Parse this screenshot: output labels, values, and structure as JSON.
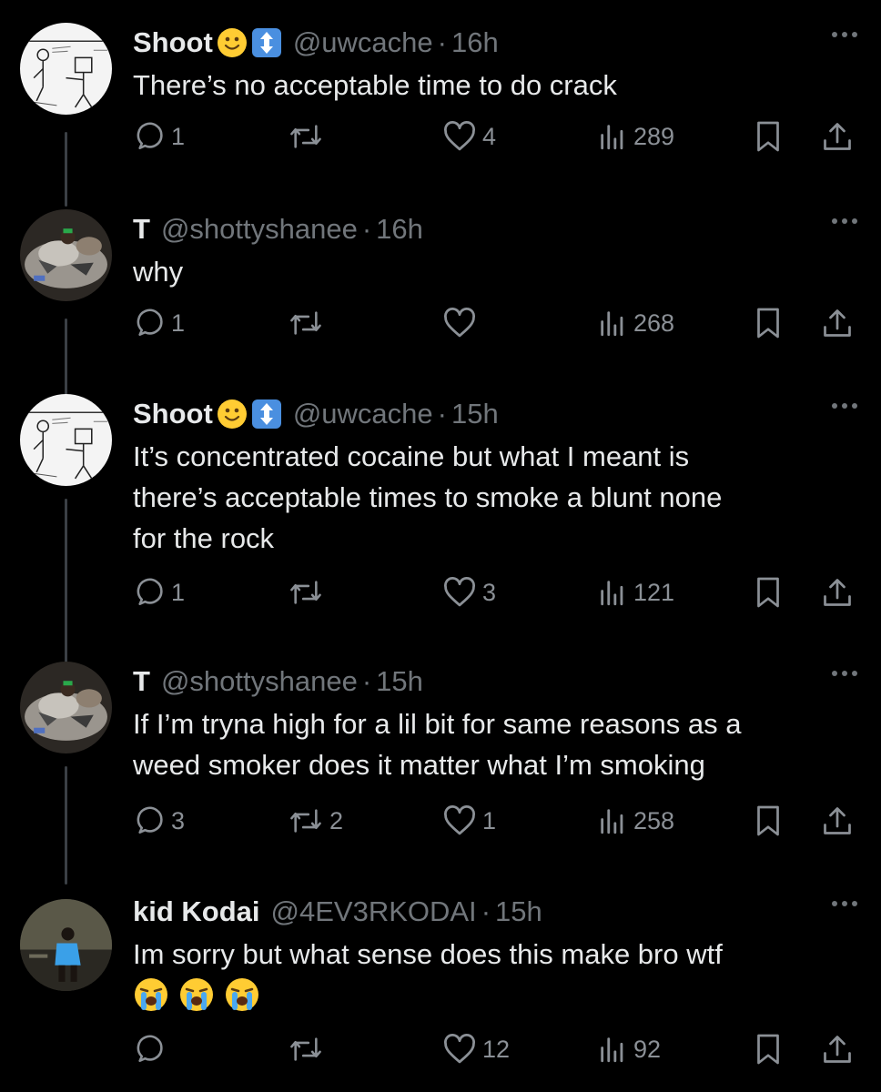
{
  "tweets": [
    {
      "name": "Shoot",
      "handle": "@uwcache",
      "sep": "·",
      "time": "16h",
      "text": [
        "There’s no acceptable time to do crack"
      ],
      "reply_count": "1",
      "retweet_count": "",
      "like_count": "4",
      "view_count": "289"
    },
    {
      "name": "T",
      "handle": "@shottyshanee",
      "sep": "·",
      "time": "16h",
      "text": [
        "why"
      ],
      "reply_count": "1",
      "retweet_count": "",
      "like_count": "",
      "view_count": "268"
    },
    {
      "name": "Shoot",
      "handle": "@uwcache",
      "sep": "·",
      "time": "15h",
      "text": [
        "It’s concentrated cocaine but what I meant is",
        "there’s acceptable times to smoke a blunt none",
        "for the rock"
      ],
      "reply_count": "1",
      "retweet_count": "",
      "like_count": "3",
      "view_count": "121"
    },
    {
      "name": "T",
      "handle": "@shottyshanee",
      "sep": "·",
      "time": "15h",
      "text": [
        "If I’m tryna high for a lil bit for same reasons as a",
        "weed smoker does it matter what I’m smoking"
      ],
      "reply_count": "3",
      "retweet_count": "2",
      "like_count": "1",
      "view_count": "258"
    },
    {
      "name": "kid Kodai",
      "handle": "@4EV3RKODAI",
      "sep": "·",
      "time": "15h",
      "text": [
        "Im sorry but what sense does this make bro wtf"
      ],
      "emoji_line": [
        "loudly-crying-face",
        "loudly-crying-face",
        "loudly-crying-face"
      ],
      "reply_count": "",
      "retweet_count": "",
      "like_count": "12",
      "view_count": "92"
    }
  ],
  "icons": {
    "badge_emoji": "slightly-smiling-face",
    "badge_arrow": "up-down-arrow",
    "reply": "reply-icon",
    "retweet": "retweet-icon",
    "like": "heart-icon",
    "views": "views-icon",
    "bookmark": "bookmark-icon",
    "share": "share-icon",
    "more": "more-icon"
  },
  "colors": {
    "background": "#000000",
    "text": "#e7e9ea",
    "muted": "#71767b",
    "thread_line": "#3b4045"
  }
}
